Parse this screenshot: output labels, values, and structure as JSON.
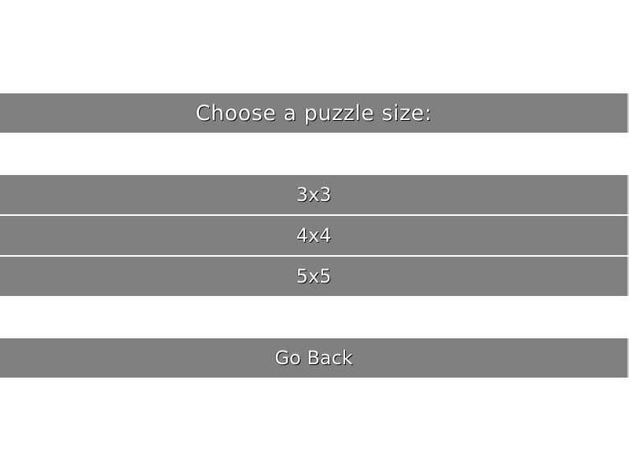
{
  "menu": {
    "title": "Choose a puzzle size:",
    "options": [
      {
        "label": "3x3"
      },
      {
        "label": "4x4"
      },
      {
        "label": "5x5"
      }
    ],
    "back_label": "Go Back"
  },
  "colors": {
    "background": "#ffffff",
    "bar": "#808080",
    "text": "#ffffff",
    "text_shadow": "#000000"
  }
}
